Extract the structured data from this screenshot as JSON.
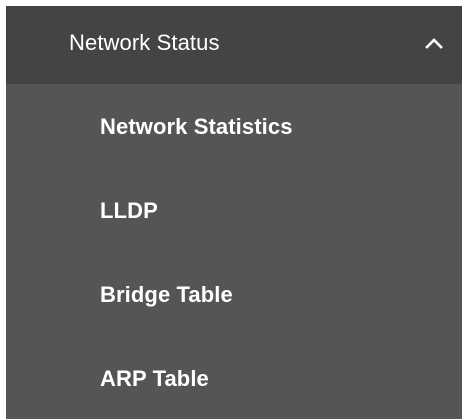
{
  "menu": {
    "header": {
      "label": "Network Status",
      "icon": "chevron-up-icon",
      "expanded": true
    },
    "items": [
      {
        "label": "Network Statistics"
      },
      {
        "label": "LLDP"
      },
      {
        "label": "Bridge Table"
      },
      {
        "label": "ARP Table"
      }
    ]
  },
  "colors": {
    "header_background": "#444444",
    "submenu_background": "#555555",
    "text": "#ffffff"
  }
}
